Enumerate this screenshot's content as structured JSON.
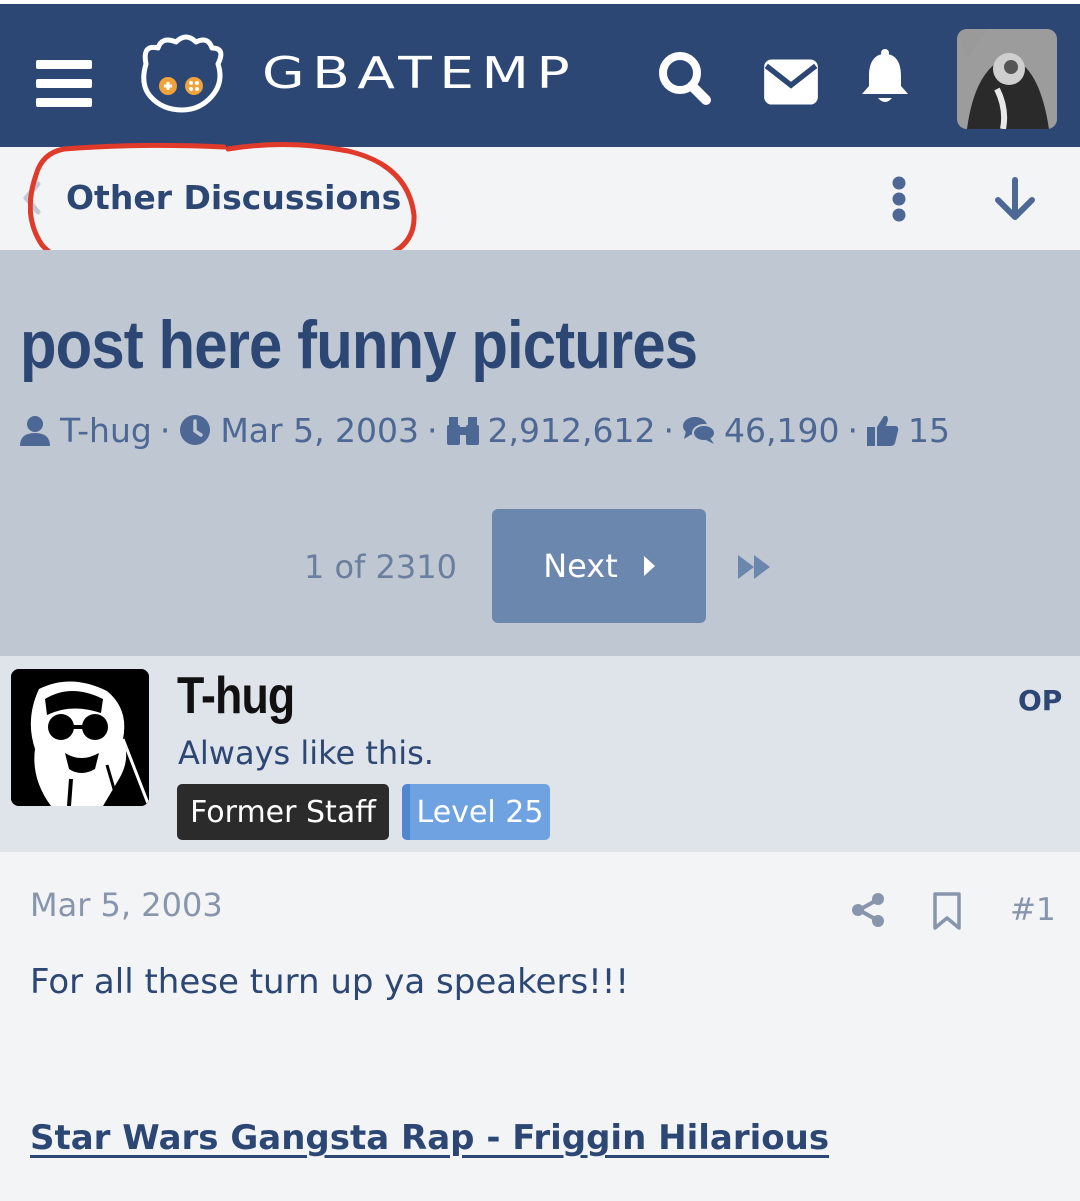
{
  "header": {
    "logo_text": "GBATEMP",
    "icons": [
      "menu-icon",
      "mascot-logo",
      "search-icon",
      "envelope-icon",
      "bell-icon",
      "user-avatar"
    ],
    "background": "#2c4774"
  },
  "breadcrumb": {
    "label": "Other Discussions",
    "annotation_color": "#e03a2b"
  },
  "thread": {
    "title": "post here funny pictures",
    "author": "T-hug",
    "date": "Mar 5, 2003",
    "views": "2,912,612",
    "replies": "46,190",
    "likes": "15"
  },
  "pager": {
    "count": "1 of 2310",
    "next_label": "Next"
  },
  "post": {
    "username": "T-hug",
    "user_title": "Always like this.",
    "badge_staff": "Former Staff",
    "badge_level": "Level 25",
    "op_label": "OP",
    "date": "Mar 5, 2003",
    "post_number": "#1",
    "text": "For all these turn up ya speakers!!!",
    "link_text": "Star Wars Gangsta Rap - Friggin Hilarious"
  },
  "colors": {
    "primary": "#2c4774",
    "title_bg": "#bfc7d2",
    "user_bg": "#dfe3ea",
    "next_button": "#6c87ad",
    "level_badge": "#6fa2e0"
  }
}
